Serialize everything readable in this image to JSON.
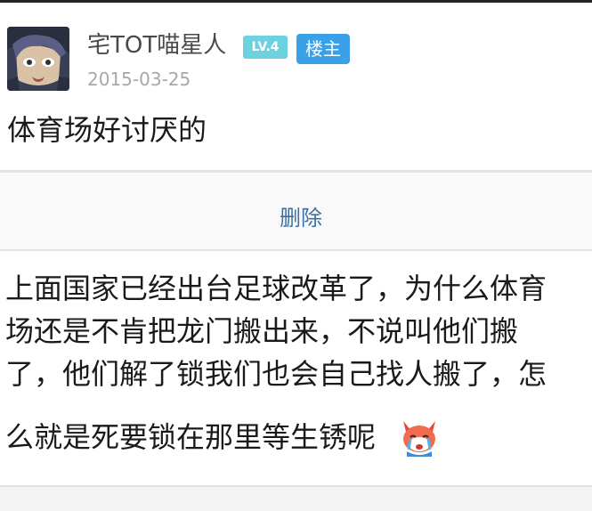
{
  "post": {
    "author": "宅TOT喵星人",
    "level_badge": "LV.4",
    "owner_badge": "楼主",
    "date": "2015-03-25",
    "body": "体育场好讨厌的",
    "avatar_icon": "anime-avatar-icon"
  },
  "actions": {
    "delete_label": "删除"
  },
  "reply": {
    "lines": [
      "上面国家已经出台足球改革了，为什么体育",
      "场还是不肯把龙门搬出来，不说叫他们搬",
      "了，他们解了锁我们也会自己找人搬了，怎",
      "么就是死要锁在那里等生锈呢"
    ],
    "emoji_icon": "crying-fox-emoji-icon"
  },
  "colors": {
    "level_badge": "#6dd2e0",
    "owner_badge": "#3aa0e8",
    "link_blue": "#3c6fa8",
    "muted_text": "#a8a8a8"
  }
}
